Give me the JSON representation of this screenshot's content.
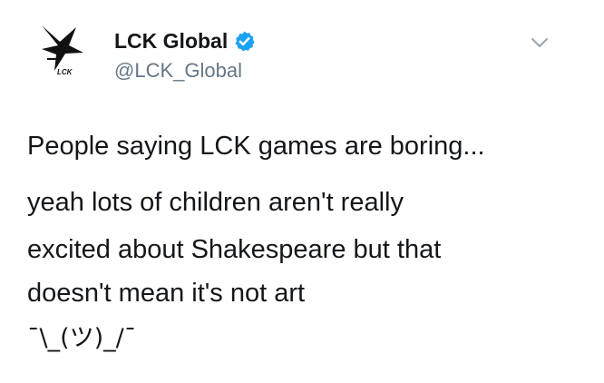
{
  "account": {
    "display_name": "LCK Global",
    "handle": "@LCK_Global",
    "avatar_icon": "lck-logo-icon",
    "verified_icon": "verified-badge-icon",
    "verified_color": "#1da1f2"
  },
  "menu": {
    "icon": "chevron-down-icon"
  },
  "tweet": {
    "line1": "People saying LCK games are boring...",
    "line2": "yeah lots of children aren't really",
    "line3": "excited about Shakespeare but that",
    "line4": "doesn't mean it's not art",
    "line5": "¯\\_(ツ)_/¯"
  },
  "logo": {
    "text": "LCK"
  }
}
